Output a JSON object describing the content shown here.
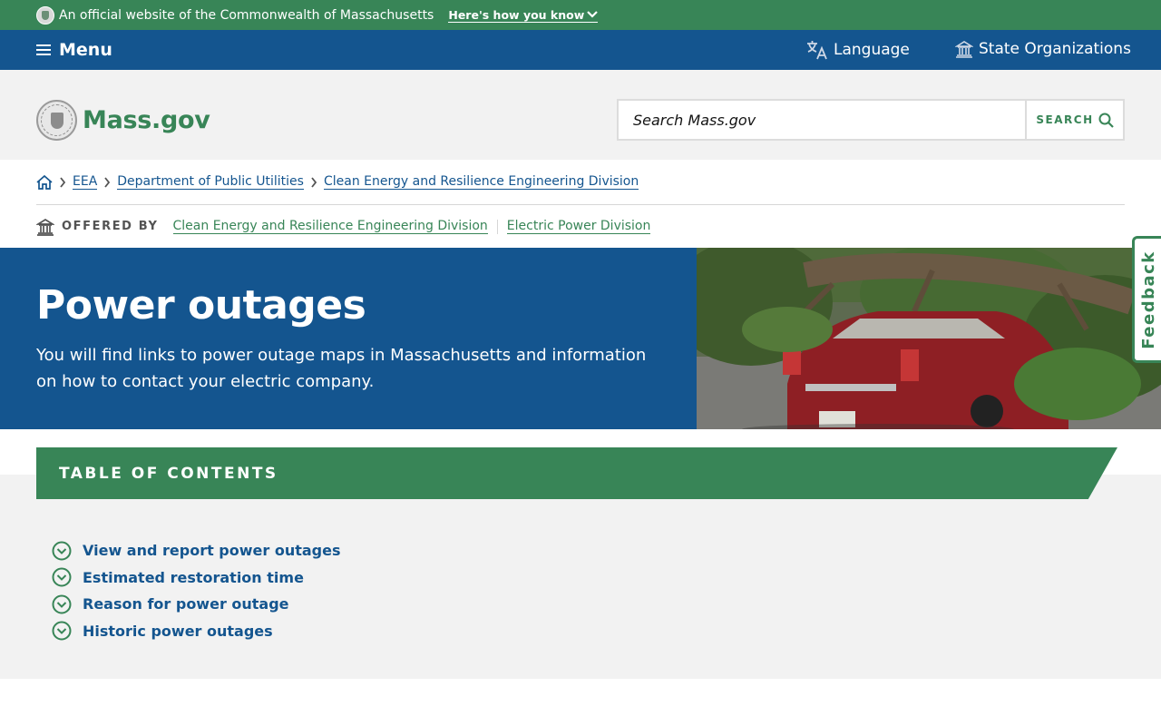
{
  "official_banner": {
    "text": "An official website of the Commonwealth of Massachusetts",
    "how_label": "Here's how you know"
  },
  "utility_nav": {
    "menu_label": "Menu",
    "language_label": "Language",
    "state_orgs_label": "State Organizations"
  },
  "header": {
    "logo_text": "Mass.gov",
    "search_placeholder": "Search Mass.gov",
    "search_button_label": "SEARCH"
  },
  "breadcrumbs": {
    "items": [
      "EEA",
      "Department of Public Utilities",
      "Clean Energy and Resilience Engineering Division"
    ]
  },
  "offered_by": {
    "label": "OFFERED BY",
    "orgs": [
      "Clean Energy and Resilience Engineering Division",
      "Electric Power Division"
    ]
  },
  "hero": {
    "title": "Power outages",
    "description": "You will find links to power outage maps in Massachusetts and information on how to contact your electric company."
  },
  "feedback_label": "Feedback",
  "toc": {
    "title": "TABLE OF CONTENTS",
    "items": [
      "View and report power outages",
      "Estimated restoration time",
      "Reason for power outage",
      "Historic power outages"
    ]
  },
  "colors": {
    "brand_green": "#388557",
    "brand_blue": "#14558f",
    "header_bg": "#f2f2f2"
  }
}
